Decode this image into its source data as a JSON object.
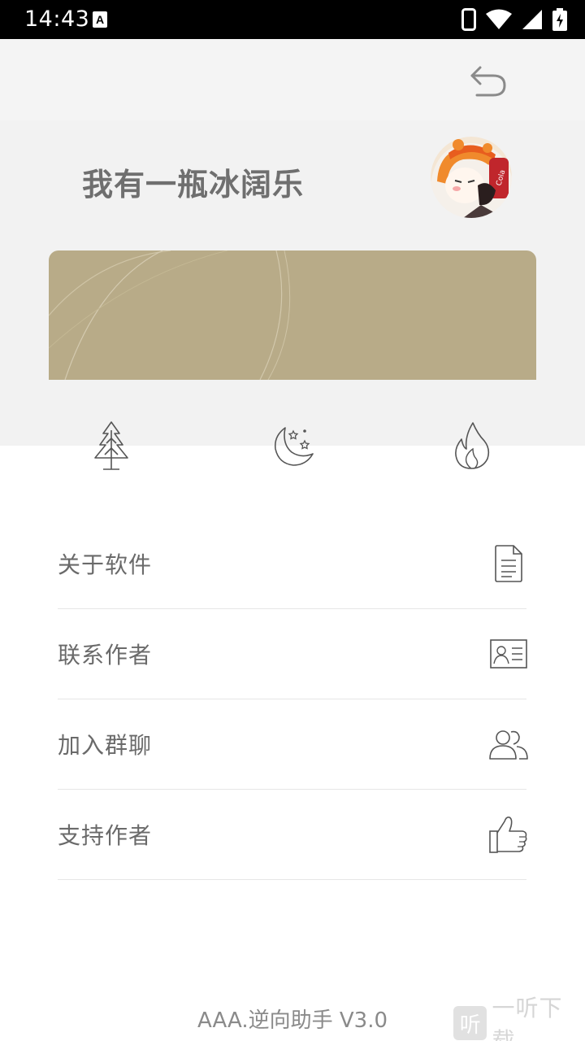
{
  "status_bar": {
    "time": "14:43",
    "notification_icon": "a-letter-icon",
    "icons": [
      "phone-icon",
      "wifi-icon",
      "cellular-signal-icon",
      "battery-charging-icon"
    ]
  },
  "header": {
    "back_icon": "undo-icon"
  },
  "profile": {
    "username": "我有一瓶冰阔乐",
    "avatar_icon": "anime-avatar"
  },
  "quick_actions": [
    {
      "icon": "tree-icon"
    },
    {
      "icon": "moon-stars-icon"
    },
    {
      "icon": "flame-icon"
    }
  ],
  "menu": {
    "items": [
      {
        "label": "关于软件",
        "icon": "document-icon"
      },
      {
        "label": "联系作者",
        "icon": "contact-card-icon"
      },
      {
        "label": "加入群聊",
        "icon": "group-icon"
      },
      {
        "label": "支持作者",
        "icon": "thumbs-up-icon"
      }
    ]
  },
  "footer": {
    "version": "AAA.逆向助手 V3.0"
  },
  "watermark": {
    "badge": "听",
    "text": "一听下载"
  },
  "colors": {
    "card": "#b8ab88",
    "top_bg": "#f2f2f2",
    "icon_stroke": "#555555"
  }
}
